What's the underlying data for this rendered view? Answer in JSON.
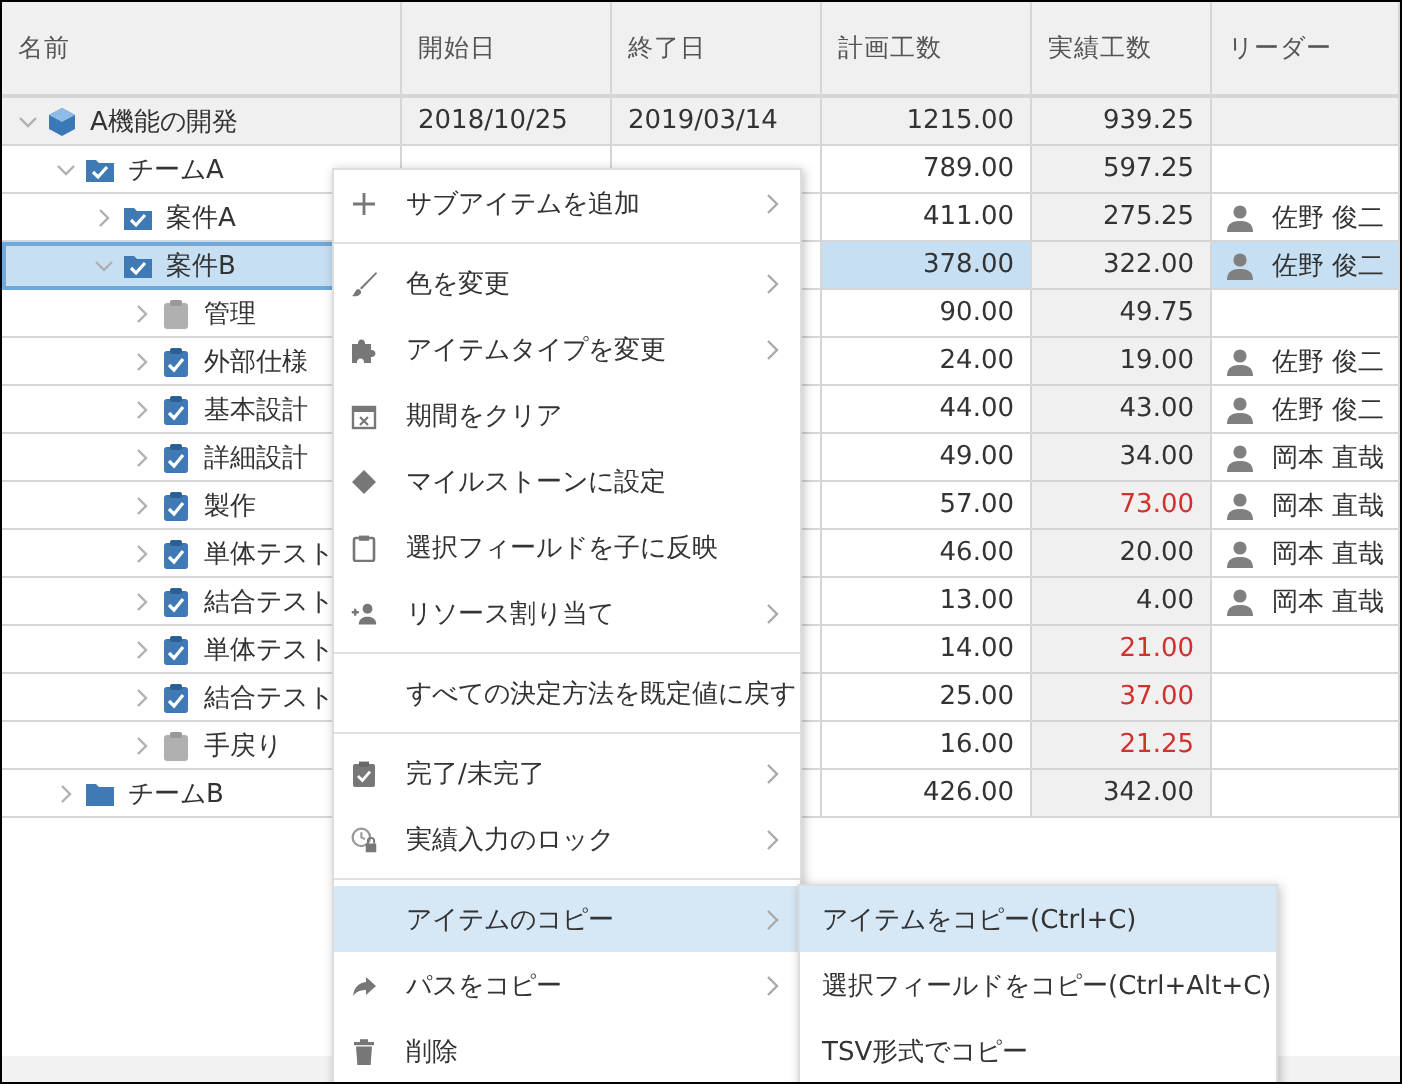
{
  "columns": [
    "名前",
    "開始日",
    "終了日",
    "計画工数",
    "実績工数",
    "リーダー"
  ],
  "rows": [
    {
      "name": "A機能の開発",
      "kind": "project",
      "expanded": true,
      "selected": false,
      "start": "2018/10/25",
      "end": "2019/03/14",
      "plan": "1215.00",
      "actual": "939.25",
      "overrun": false,
      "children": [
        {
          "name": "チームA",
          "kind": "folder",
          "checked": true,
          "expanded": true,
          "selected": false,
          "plan": "789.00",
          "actual": "597.25",
          "overrun": false,
          "children": [
            {
              "name": "案件A",
              "kind": "folder",
              "checked": true,
              "expanded": false,
              "selected": false,
              "plan": "411.00",
              "actual": "275.25",
              "overrun": false,
              "leader": "佐野 俊二"
            },
            {
              "name": "案件B",
              "kind": "folder",
              "checked": true,
              "expanded": true,
              "selected": true,
              "plan": "378.00",
              "actual": "322.00",
              "overrun": false,
              "leader": "佐野 俊二",
              "children": [
                {
                  "name": "管理",
                  "kind": "task",
                  "checked": false,
                  "expanded": false,
                  "selected": false,
                  "plan": "90.00",
                  "actual": "49.75",
                  "overrun": false
                },
                {
                  "name": "外部仕様",
                  "kind": "task",
                  "checked": true,
                  "expanded": false,
                  "selected": false,
                  "plan": "24.00",
                  "actual": "19.00",
                  "overrun": false,
                  "leader": "佐野 俊二"
                },
                {
                  "name": "基本設計",
                  "kind": "task",
                  "checked": true,
                  "expanded": false,
                  "selected": false,
                  "plan": "44.00",
                  "actual": "43.00",
                  "overrun": false,
                  "leader": "佐野 俊二"
                },
                {
                  "name": "詳細設計",
                  "kind": "task",
                  "checked": true,
                  "expanded": false,
                  "selected": false,
                  "plan": "49.00",
                  "actual": "34.00",
                  "overrun": false,
                  "leader": "岡本 直哉"
                },
                {
                  "name": "製作",
                  "kind": "task",
                  "checked": true,
                  "expanded": false,
                  "selected": false,
                  "plan": "57.00",
                  "actual": "73.00",
                  "overrun": true,
                  "leader": "岡本 直哉"
                },
                {
                  "name": "単体テスト",
                  "kind": "task",
                  "checked": true,
                  "expanded": false,
                  "selected": false,
                  "plan": "46.00",
                  "actual": "20.00",
                  "overrun": false,
                  "leader": "岡本 直哉"
                },
                {
                  "name": "結合テスト",
                  "kind": "task",
                  "checked": true,
                  "expanded": false,
                  "selected": false,
                  "plan": "13.00",
                  "actual": "4.00",
                  "overrun": false,
                  "leader": "岡本 直哉"
                },
                {
                  "name": "単体テスト",
                  "kind": "task",
                  "checked": true,
                  "expanded": false,
                  "selected": false,
                  "plan": "14.00",
                  "actual": "21.00",
                  "overrun": true
                },
                {
                  "name": "結合テスト",
                  "kind": "task",
                  "checked": true,
                  "expanded": false,
                  "selected": false,
                  "plan": "25.00",
                  "actual": "37.00",
                  "overrun": true
                },
                {
                  "name": "手戻り",
                  "kind": "task",
                  "checked": false,
                  "expanded": false,
                  "selected": false,
                  "plan": "16.00",
                  "actual": "21.25",
                  "overrun": true
                }
              ]
            }
          ]
        },
        {
          "name": "チームB",
          "kind": "folder",
          "checked": false,
          "expanded": false,
          "selected": false,
          "plan": "426.00",
          "actual": "342.00",
          "overrun": false
        }
      ]
    }
  ],
  "context_menu": {
    "items": [
      {
        "kind": "item",
        "label": "サブアイテムを追加",
        "submenu": true,
        "selected": false
      },
      {
        "kind": "separator"
      },
      {
        "kind": "item",
        "label": "色を変更",
        "submenu": true,
        "selected": false
      },
      {
        "kind": "item",
        "label": "アイテムタイプを変更",
        "submenu": true,
        "selected": false
      },
      {
        "kind": "item",
        "label": "期間をクリア",
        "submenu": false,
        "selected": false
      },
      {
        "kind": "item",
        "label": "マイルストーンに設定",
        "submenu": false,
        "selected": false
      },
      {
        "kind": "item",
        "label": "選択フィールドを子に反映",
        "submenu": false,
        "selected": false
      },
      {
        "kind": "item",
        "label": "リソース割り当て",
        "submenu": true,
        "selected": false
      },
      {
        "kind": "separator"
      },
      {
        "kind": "item",
        "label": "すべての決定方法を既定値に戻す",
        "submenu": false,
        "selected": false
      },
      {
        "kind": "separator"
      },
      {
        "kind": "item",
        "label": "完了/未完了",
        "submenu": true,
        "selected": false
      },
      {
        "kind": "item",
        "label": "実績入力のロック",
        "submenu": true,
        "selected": false
      },
      {
        "kind": "separator"
      },
      {
        "kind": "item",
        "label": "アイテムのコピー",
        "submenu": true,
        "selected": true
      },
      {
        "kind": "item",
        "label": "パスをコピー",
        "submenu": true,
        "selected": false
      },
      {
        "kind": "item",
        "label": "削除",
        "submenu": false,
        "selected": false
      }
    ]
  },
  "submenu": {
    "items": [
      {
        "label": "アイテムをコピー(Ctrl+C)",
        "selected": true
      },
      {
        "label": "選択フィールドをコピー(Ctrl+Alt+C)",
        "selected": false
      },
      {
        "label": "TSV形式でコピー",
        "selected": false
      }
    ]
  }
}
